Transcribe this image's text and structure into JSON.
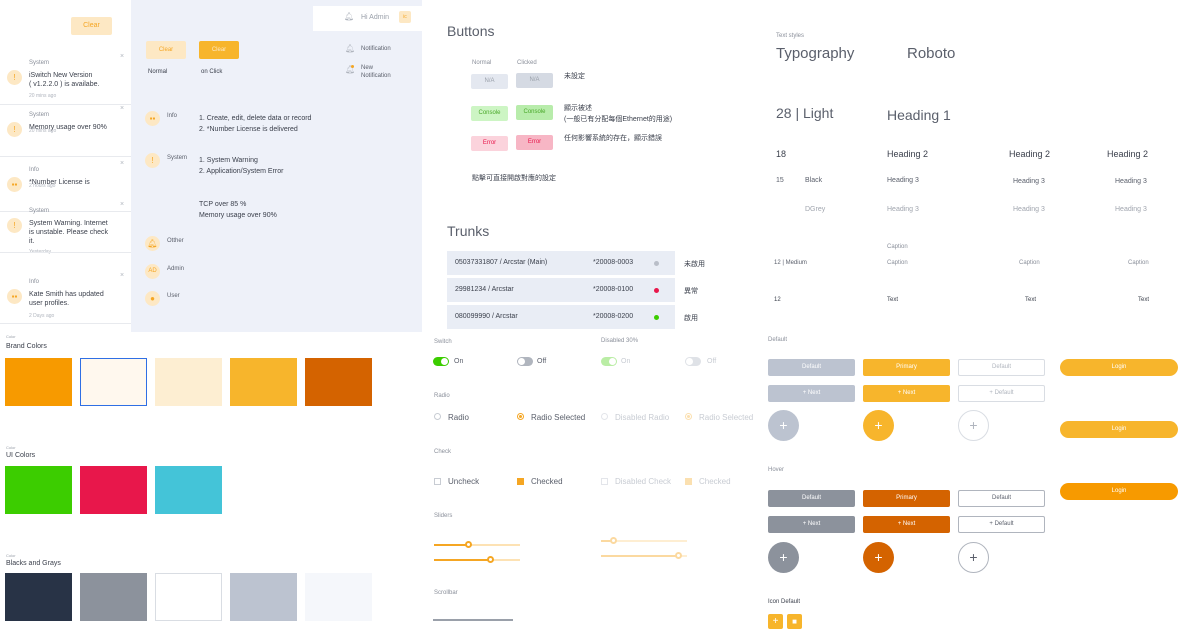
{
  "notif_panel": {
    "clear_label": "Clear",
    "items": [
      {
        "category": "System",
        "message": "iSwitch New Version\n( v1.2.2.0 ) is availabe.",
        "time": "20 mins ago",
        "icon": "alert-icon"
      },
      {
        "category": "System",
        "message": "Memory usage over 90%",
        "time": "20 mins ago",
        "icon": "alert-icon"
      },
      {
        "category": "Info",
        "message": "*Number License is",
        "time": "2 hours ago",
        "icon": "grid-icon"
      },
      {
        "category": "System",
        "message": "System Warning. Internet\nis unstable. Please check\nit.",
        "time": "Yesterday",
        "icon": "alert-icon"
      },
      {
        "category": "Info",
        "message": "Kate Smith has updated\nuser profiles.",
        "time": "2 Days ago",
        "icon": "grid-icon"
      }
    ]
  },
  "header": {
    "greeting": "Hi Admin",
    "avatar": "ic"
  },
  "clear_demo": {
    "normal_btn": "Clear",
    "click_btn": "Clear",
    "normal_label": "Normal",
    "click_label": "on Click"
  },
  "legend_types": [
    {
      "label": "Info",
      "lines": "1. Create, edit, delete data or record\n2. *Number License is delivered",
      "icon": "grid-icon"
    },
    {
      "label": "System",
      "lines": "1. System Warning\n2. Application/System Error\n\n\nTCP over 85 %\nMemory usage over 90%",
      "icon": "alert-icon"
    },
    {
      "label": "Otther",
      "lines": "",
      "icon": "bell-icon"
    },
    {
      "label": "Admin",
      "lines": "",
      "icon": "AD"
    },
    {
      "label": "User",
      "lines": "",
      "icon": "user-icon"
    }
  ],
  "notif_legend": {
    "notification": "Notification",
    "new_notification": "New\nNotification"
  },
  "colors": {
    "brand_label": "Brand Colors",
    "brand_tag": "Color",
    "brand": [
      "#f79a00",
      "#fff8ee",
      "#fdeed2",
      "#f7b52c",
      "#d46300"
    ],
    "ui_label": "UI Colors",
    "ui_tag": "Color",
    "ui": [
      "#3ccd00",
      "#e8174b",
      "#44c4d8"
    ],
    "grays_label": "Blacks and Grays",
    "grays_tag": "Color",
    "grays": [
      "#283346",
      "#8c929c",
      "#ffffff",
      "#bcc3d0",
      "#f5f7fb"
    ]
  },
  "buttons": {
    "title": "Buttons",
    "col_normal": "Normal",
    "col_clicked": "Clicked",
    "rows": [
      {
        "label": "N/A",
        "desc": "未設定"
      },
      {
        "label": "Console",
        "desc": "顯示被述\n(一般已有分配每個Ethernet的用途)"
      },
      {
        "label": "Error",
        "desc": "任何影響系統的存在，顯示錯誤"
      }
    ],
    "footer": "點擊可直接開啟對應的設定"
  },
  "trunks": {
    "title": "Trunks",
    "rows": [
      {
        "name": "05037331807 / Arcstar (Main)",
        "code": "*20008-0003",
        "status": "未啟用",
        "color": "#b9bec8"
      },
      {
        "name": "29981234 / Arcstar",
        "code": "*20008-0100",
        "status": "異常",
        "color": "#e8174b"
      },
      {
        "name": "080099990 / Arcstar",
        "code": "*20008-0200",
        "status": "啟用",
        "color": "#3ccd00"
      }
    ]
  },
  "controls": {
    "switch_label": "Switch",
    "disabled_label": "Disabled 30%",
    "on": "On",
    "off": "Off",
    "radio_label": "Radio",
    "radio": "Radio",
    "radio_selected": "Radio Selected",
    "disabled_radio": "Disabled Radio",
    "check_label": "Check",
    "uncheck": "Uncheck",
    "checked": "Checked",
    "disabled_check": "Disabled Check",
    "sliders_label": "Sliders",
    "scrollbar_label": "Scrollbar",
    "sliders": [
      0.25,
      0.41
    ],
    "sliders_disabled": [
      0.1,
      0.62
    ]
  },
  "typography": {
    "tag": "Text styles",
    "typography": "Typography",
    "font": "Roboto",
    "light": "28 | Light",
    "h1": "Heading 1",
    "s18": "18",
    "h2": "Heading 2",
    "s15": "15",
    "black": "Black",
    "h3": "Heading 3",
    "dgrey": "DGrey",
    "caption_head": "Caption",
    "medium": "12 | Medium",
    "caption": "Caption",
    "s12": "12",
    "text": "Text"
  },
  "btn_styles": {
    "default_label": "Default",
    "hover_label": "Hover",
    "icon_default": "Icon Default",
    "default": "Default",
    "primary": "Primary",
    "next": "Next",
    "login": "Login"
  }
}
